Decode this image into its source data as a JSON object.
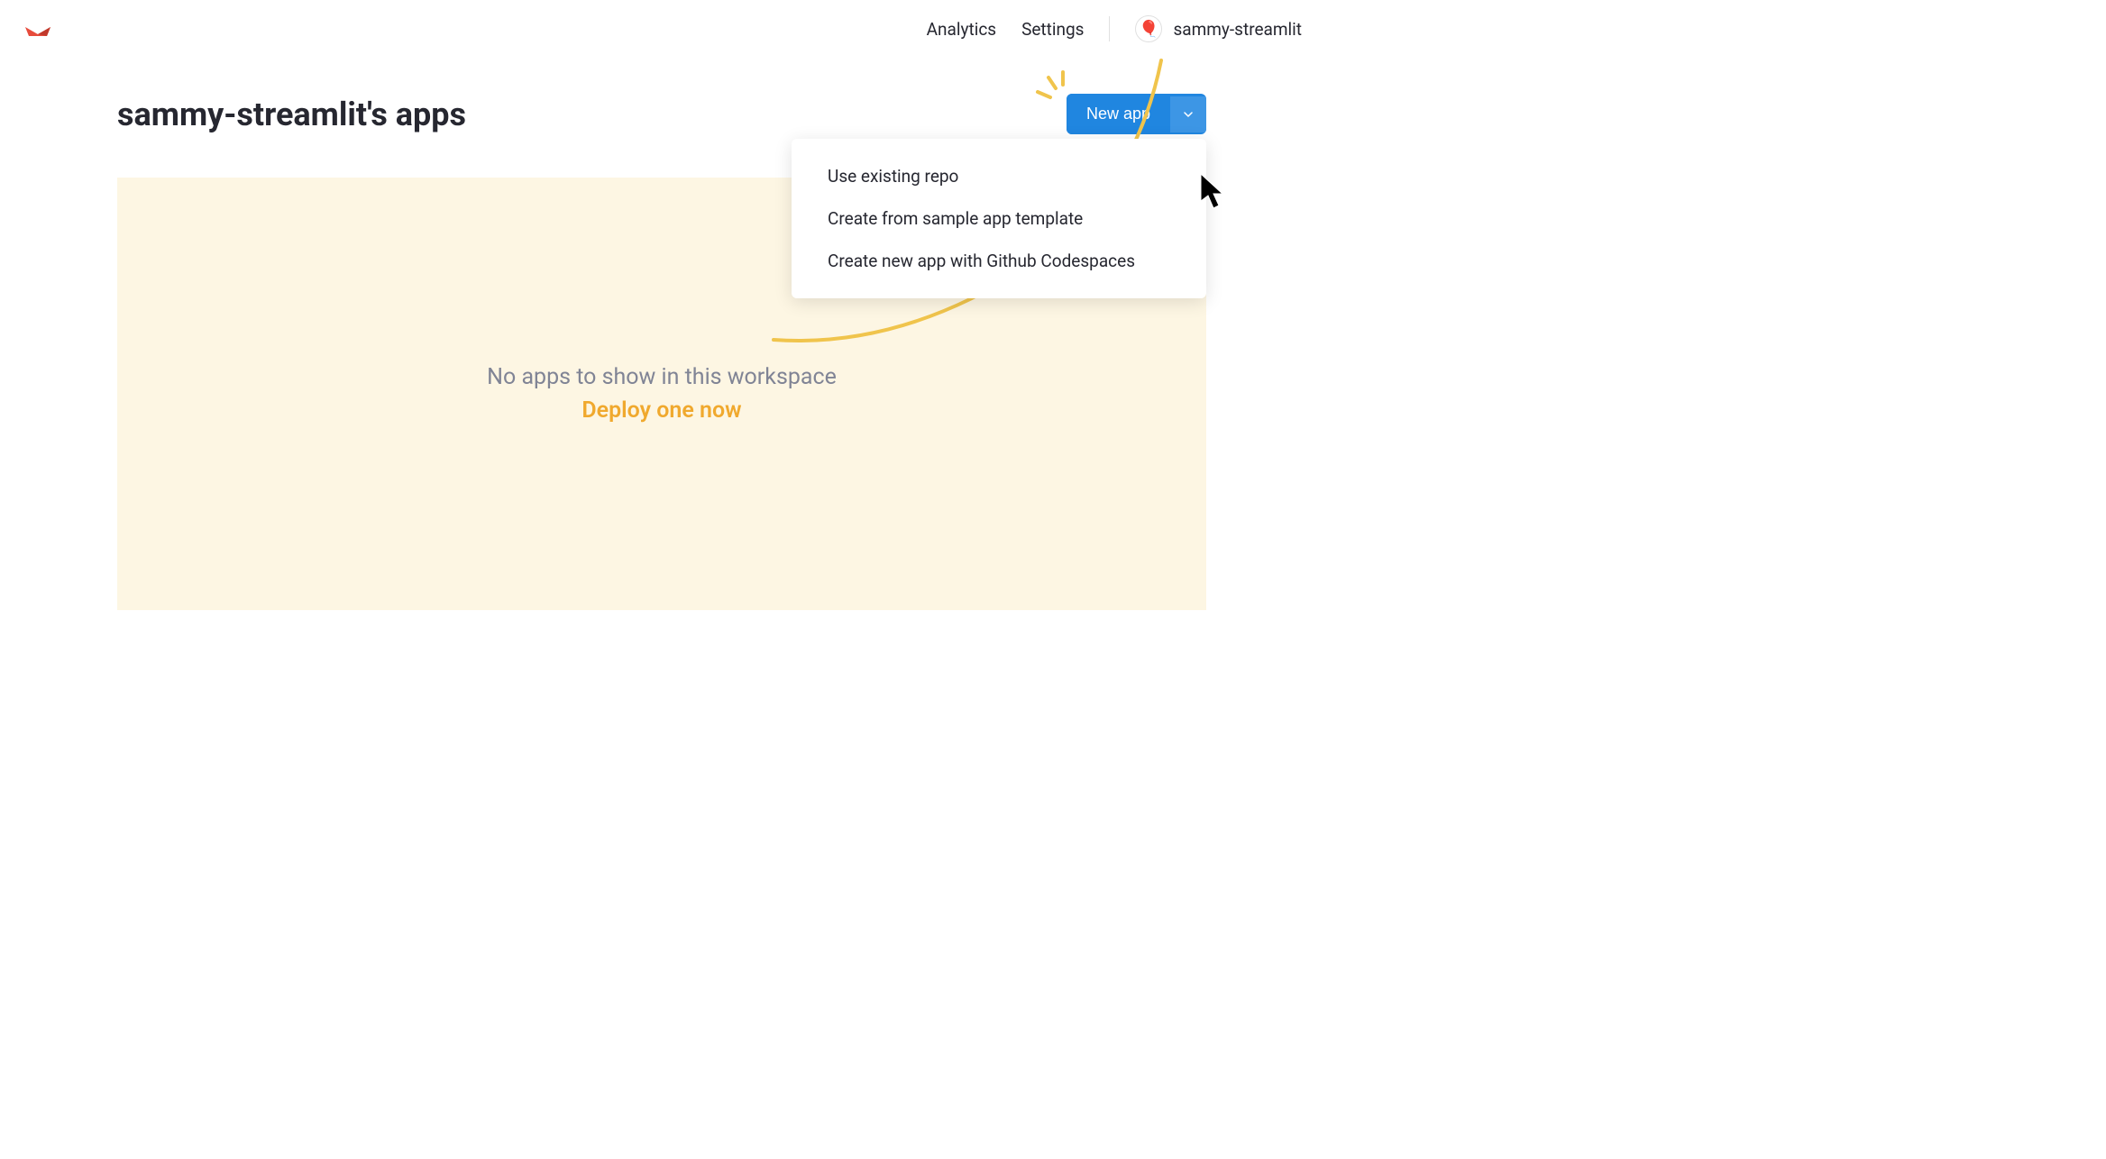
{
  "header": {
    "nav": {
      "analytics": "Analytics",
      "settings": "Settings"
    },
    "user": {
      "name": "sammy-streamlit"
    }
  },
  "main": {
    "title": "sammy-streamlit's apps",
    "newapp": {
      "label": "New app",
      "menu": [
        "Use existing repo",
        "Create from sample app template",
        "Create new app with Github Codespaces"
      ]
    },
    "empty": {
      "message": "No apps to show in this workspace",
      "cta": "Deploy one now"
    }
  }
}
